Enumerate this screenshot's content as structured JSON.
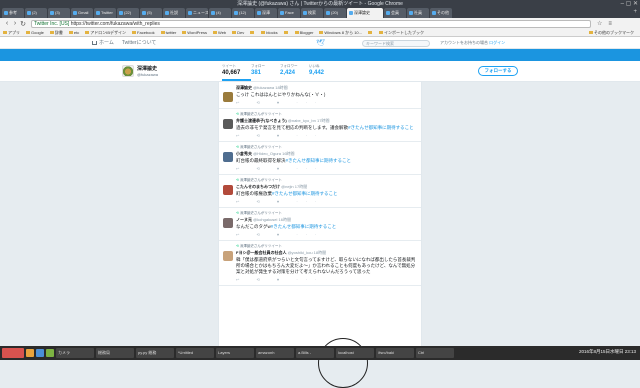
{
  "browser": {
    "window_title": "深澤論史 (@fukazawa) さん | Twitterからの最新ツイート - Google Chrome",
    "tabs": [
      {
        "label": "参考"
      },
      {
        "label": "(2)"
      },
      {
        "label": "(3)"
      },
      {
        "label": "Gmail"
      },
      {
        "label": "Twitter"
      },
      {
        "label": "(22)"
      },
      {
        "label": "(5)"
      },
      {
        "label": "社説"
      },
      {
        "label": "ニュース"
      },
      {
        "label": "(4)"
      },
      {
        "label": "(12)"
      },
      {
        "label": "深澤"
      },
      {
        "label": "Face"
      },
      {
        "label": "検索"
      },
      {
        "label": "(20)"
      },
      {
        "label": "深澤論史",
        "active": true
      },
      {
        "label": "会員"
      },
      {
        "label": "社員"
      },
      {
        "label": "その他"
      }
    ],
    "url_secure_label": "Twitter Inc. [US]",
    "url": "https://twitter.com/fukazawa/with_replies",
    "bookmarks": [
      "アプリ",
      "Google",
      "辞書",
      "etc",
      "アドロンIBデザイン",
      "Facebook",
      "twitter",
      "WordPress",
      "Web",
      "Dev",
      "",
      "blocks",
      "",
      "Blogger",
      "Windows 8 から 10...",
      "",
      "インポートしたブック"
    ],
    "bookmarks_overflow": "その他のブックマーク"
  },
  "twitter_nav": {
    "home": "ホーム",
    "about": "Twitterについて",
    "search_placeholder": "キーワード検索",
    "account_prompt": "アカウントをお持ちの場合",
    "login": "ログイン"
  },
  "profile": {
    "name": "深澤諭史",
    "handle": "@fukazawa",
    "stats": [
      {
        "label": "ツイート",
        "value": "40,667",
        "active": true
      },
      {
        "label": "フォロー",
        "value": "381"
      },
      {
        "label": "フォロワー",
        "value": "2,424"
      },
      {
        "label": "いいね",
        "value": "9,442"
      }
    ],
    "follow_label": "フォローする"
  },
  "tweets": [
    {
      "retweet": "",
      "name": "深澤諭史",
      "handle": "@fukazawa",
      "time": "18時間",
      "body": "こっけ\nこれはほんとにやりかねんな(・∀・)",
      "tag": "",
      "avatar_color": "#9a7b3c"
    },
    {
      "retweet": "深澤諭史さんがリツイート",
      "name": "弁護士渡邊恭子(なべきょう)",
      "handle": "@nabe_kyo_bn",
      "time": "17時間",
      "body": "過去の非モテ発言を見て相応の判断をします。議会解散",
      "tag": "#きたんせ都知事に期待すること",
      "avatar_color": "#5a5a5a"
    },
    {
      "retweet": "深澤諭史さんがリツイート",
      "name": "小倉秀夫",
      "handle": "@Hideo_Ogura",
      "time": "16時間",
      "body": "町台帳の最終取得を解決",
      "tag": "#きたんせ都知事に期待すること",
      "avatar_color": "#4f6d8f"
    },
    {
      "retweet": "深澤諭史さんがリツイート",
      "name": "こたんせのまちみつだけ",
      "handle": "@nejin",
      "time": "17時間",
      "body": "町台帳の帳権放棄",
      "tag": "#きたんせ都知事に期待すること",
      "avatar_color": "#b24a3a"
    },
    {
      "retweet": "深澤諭史さんがリツイート",
      "name": "ノーヌ元",
      "handle": "@kohgakusei",
      "time": "16時間",
      "body": "なんだこのタグw",
      "tag": "#きたんせ都知事に期待すること",
      "avatar_color": "#7a6a6a"
    },
    {
      "retweet": "深澤諭史さんがリツイート",
      "name": "Fヨシ＠一般会社員の社会人",
      "handle": "@yoshiki_kou",
      "time": "18時間",
      "body": "韓「僕は都道府県がつらいと文句言ってますけど、取らないになれば都出したら首長裁判所の場合とかはもちろん大変だよ〜」か言われることも何度もあったけど、なんで無処分案と対処が発生する対策を分けて考えられないんだろうって思った",
      "tag": "",
      "avatar_color": "#c8a27a"
    }
  ],
  "taskbar": {
    "items": [
      {
        "label": "カメラ"
      },
      {
        "label": "総務局"
      },
      {
        "label": "py.py 総務"
      },
      {
        "label": "*Untitled"
      },
      {
        "label": "Layers"
      },
      {
        "label": "amazonh"
      },
      {
        "label": "a.Bills -"
      },
      {
        "label": "localhost"
      },
      {
        "label": "/fsrc/baki"
      },
      {
        "label": "Ctrl"
      }
    ],
    "clock": "2016年8月15日水曜日 23:13"
  }
}
